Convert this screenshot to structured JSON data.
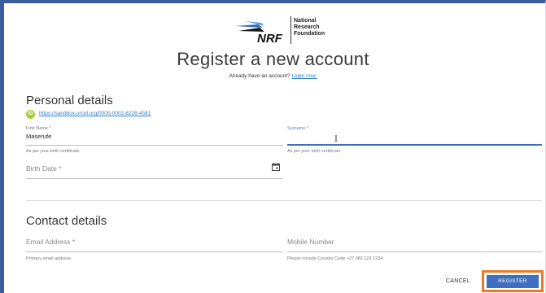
{
  "brand": {
    "logo_text": "NRF",
    "name_lines": [
      "National",
      "Research",
      "Foundation"
    ]
  },
  "page": {
    "title": "Register a new account",
    "already_text": "Already have an account?",
    "login_link": "Login now."
  },
  "personal": {
    "heading": "Personal details",
    "orcid_icon_text": "iD",
    "orcid_url": "https://sandbox.orcid.org/0000-0002-8226-4581",
    "first_name": {
      "label": "First Name *",
      "value": "Maserufe",
      "hint": "As per your birth certificate"
    },
    "surname": {
      "label": "Surname *",
      "value": "",
      "hint": "As per your birth certificate"
    },
    "birth_date": {
      "placeholder": "Birth Date *"
    }
  },
  "contact": {
    "heading": "Contact details",
    "email": {
      "placeholder": "Email Address *",
      "hint": "Primary email address"
    },
    "mobile": {
      "placeholder": "Mobile Number",
      "hint": "Please include Country Code +27 082 123 1234"
    }
  },
  "actions": {
    "cancel": "CANCEL",
    "register": "REGISTER"
  },
  "colors": {
    "accent": "#3f6fc2",
    "link": "#2f7fd1",
    "highlight": "#e97a27",
    "orcid": "#a6ce39"
  }
}
